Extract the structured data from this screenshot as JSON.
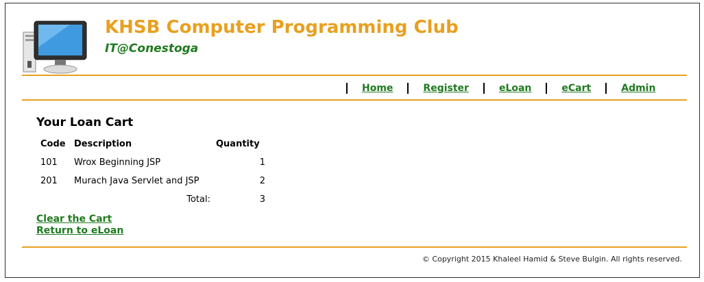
{
  "header": {
    "title": "KHSB Computer Programming Club",
    "subtitle": "IT@Conestoga",
    "logo_icon": "computer-monitor-icon",
    "colors": {
      "title": "#e8a020",
      "subtitle": "#1f7a1f",
      "rule": "#e8a020"
    }
  },
  "nav": {
    "home": "Home",
    "register": "Register",
    "eloan": "eLoan",
    "ecart": "eCart",
    "admin": "Admin"
  },
  "cart": {
    "title": "Your Loan Cart",
    "headers": {
      "code": "Code",
      "description": "Description",
      "quantity": "Quantity"
    },
    "rows": [
      {
        "code": "101",
        "description": "Wrox Beginning JSP",
        "quantity": "1"
      },
      {
        "code": "201",
        "description": "Murach Java Servlet and JSP",
        "quantity": "2"
      }
    ],
    "total_label": "Total:",
    "total_value": "3"
  },
  "links": {
    "clear": "Clear the Cart",
    "return": "Return to eLoan"
  },
  "footer": {
    "copyright": "© Copyright 2015 Khaleel Hamid & Steve Bulgin. All rights reserved."
  }
}
